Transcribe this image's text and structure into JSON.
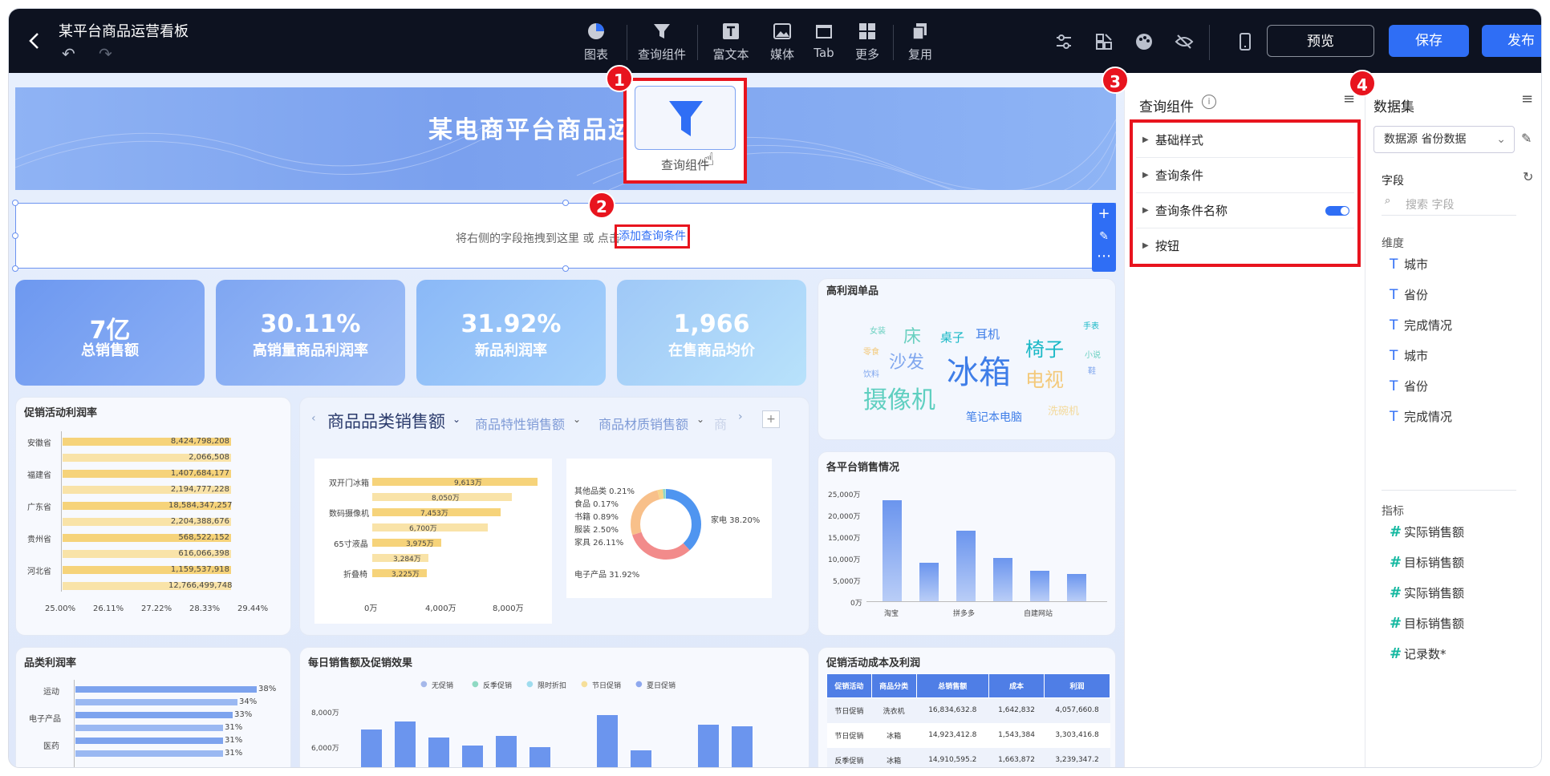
{
  "header": {
    "title": "某平台商品运营看板",
    "back_icon": "chevron-left-icon"
  },
  "toolbar": {
    "items": [
      {
        "label": "图表",
        "icon": "pie-chart-icon"
      },
      {
        "label": "查询组件",
        "icon": "filter-icon"
      },
      {
        "label": "富文本",
        "icon": "text-icon"
      },
      {
        "label": "媒体",
        "icon": "image-icon"
      },
      {
        "label": "Tab",
        "icon": "tab-icon"
      },
      {
        "label": "更多",
        "icon": "grid-icon"
      },
      {
        "label": "复用",
        "icon": "copy-icon"
      }
    ],
    "preview": "预览",
    "save": "保存",
    "publish": "发布"
  },
  "drag_preview": {
    "label": "查询组件"
  },
  "canvas": {
    "banner_title": "某电商平台商品运",
    "query_hint": "将右侧的字段拖拽到这里 或 点击",
    "query_link": "添加查询条件",
    "kpis": [
      {
        "value": "7亿",
        "label": "总销售额"
      },
      {
        "value": "30.11%",
        "label": "高销量商品利润率"
      },
      {
        "value": "31.92%",
        "label": "新品利润率"
      },
      {
        "value": "1,966",
        "label": "在售商品均价"
      }
    ],
    "wordcloud": {
      "title": "高利润单品",
      "words": [
        {
          "text": "冰箱",
          "color": "#3f7ee8"
        },
        {
          "text": "摄像机",
          "color": "#5fcfc0"
        },
        {
          "text": "椅子",
          "color": "#19b8c6"
        },
        {
          "text": "电视",
          "color": "#f3c97a"
        },
        {
          "text": "沙发",
          "color": "#7fa6ee"
        },
        {
          "text": "床",
          "color": "#6ad0c0"
        },
        {
          "text": "桌子",
          "color": "#19b8c6"
        },
        {
          "text": "耳机",
          "color": "#3f7ee8"
        },
        {
          "text": "笔记本电脑",
          "color": "#3f7ee8"
        },
        {
          "text": "洗碗机",
          "color": "#f3d99a"
        },
        {
          "text": "手表",
          "color": "#19b8c6"
        },
        {
          "text": "女装",
          "color": "#6ad0c0"
        },
        {
          "text": "零食",
          "color": "#f3c97a"
        },
        {
          "text": "饮料",
          "color": "#7fa6ee"
        },
        {
          "text": "小说",
          "color": "#6ad0c0"
        },
        {
          "text": "鞋",
          "color": "#7fa6ee"
        }
      ]
    },
    "promo_profit": {
      "title": "促销活动利润率",
      "provinces": [
        "安徽省",
        "福建省",
        "广东省",
        "贵州省",
        "河北省"
      ],
      "values": [
        "8,424,798,208",
        "2,066,508",
        "1,407,684,177",
        "2,194,777,228",
        "18,584,347,257",
        "2,204,388,676",
        "568,522,152",
        "616,066,398",
        "1,159,537,918",
        "12,766,499,748"
      ],
      "xticks": [
        "25.00%",
        "26.11%",
        "27.22%",
        "28.33%",
        "29.44%"
      ]
    },
    "tabs": {
      "active": "商品品类销售额",
      "others": [
        "商品特性销售额",
        "商品材质销售额"
      ],
      "cut": "商"
    },
    "category_bar": {
      "labels": [
        "双开门冰箱",
        "数码摄像机",
        "65寸液晶",
        "折叠椅"
      ],
      "values": [
        "9,613万",
        "8,050万",
        "7,453万",
        "6,700万",
        "3,975万",
        "3,284万",
        "3,225万"
      ],
      "xticks": [
        "0万",
        "4,000万",
        "8,000万"
      ]
    },
    "donut": {
      "slices": [
        {
          "label": "家电 38.20%",
          "color": "#4f95f0"
        },
        {
          "label": "电子产品 31.92%",
          "color": "#f28b8b"
        },
        {
          "label": "家具 26.11%",
          "color": "#f8c08a"
        },
        {
          "label": "服装 2.50%",
          "color": "#f6d48a"
        },
        {
          "label": "书籍 0.89%",
          "color": "#8fd9c3"
        },
        {
          "label": "食品 0.17%",
          "color": "#a6dcef"
        },
        {
          "label": "其他品类 0.21%",
          "color": "#c8b6f0"
        }
      ]
    },
    "platform": {
      "title": "各平台销售情况",
      "yticks": [
        "25,000万",
        "20,000万",
        "15,000万",
        "10,000万",
        "5,000万",
        "0万"
      ],
      "xlabels": [
        "淘宝",
        "拼多多",
        "自建网站"
      ]
    },
    "cat_profit": {
      "title": "品类利润率",
      "labels": [
        "运动",
        "电子产品",
        "医药"
      ],
      "values": [
        "38%",
        "34%",
        "33%",
        "31%",
        "31%",
        "31%"
      ]
    },
    "daily": {
      "title": "每日销售额及促销效果",
      "legend": [
        "无促销",
        "反季促销",
        "限时折扣",
        "节日促销",
        "夏日促销"
      ],
      "yticks": [
        "8,000万",
        "6,000万"
      ]
    },
    "promo_table": {
      "title": "促销活动成本及利润",
      "headers": [
        "促销活动",
        "商品分类",
        "总销售额",
        "成本",
        "利润"
      ],
      "rows": [
        [
          "节日促销",
          "洗衣机",
          "16,834,632.8",
          "1,642,832",
          "4,057,660.8"
        ],
        [
          "节日促销",
          "冰箱",
          "14,923,412.8",
          "1,543,384",
          "3,303,416.8"
        ],
        [
          "反季促销",
          "冰箱",
          "14,910,595.2",
          "1,663,872",
          "3,239,347.2"
        ]
      ]
    }
  },
  "props_panel": {
    "title": "查询组件",
    "sections": [
      "基础样式",
      "查询条件",
      "查询条件名称",
      "按钮"
    ]
  },
  "data_panel": {
    "title": "数据集",
    "dataset": "数据源 省份数据",
    "fields_label": "字段",
    "search_placeholder": "搜索 字段",
    "dim_label": "维度",
    "dimensions": [
      "城市",
      "省份",
      "完成情况",
      "城市",
      "省份",
      "完成情况"
    ],
    "measure_label": "指标",
    "measures": [
      "实际销售额",
      "目标销售额",
      "实际销售额",
      "目标销售额",
      "记录数*"
    ]
  },
  "badges": [
    "1",
    "2",
    "3",
    "4"
  ]
}
